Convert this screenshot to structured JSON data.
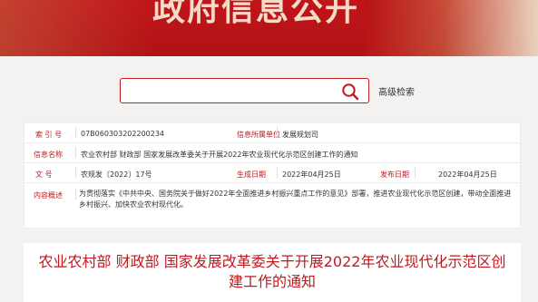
{
  "banner": {
    "title": "政府信息公开"
  },
  "search": {
    "placeholder": "",
    "advanced_label": "高级检索"
  },
  "info": {
    "index_no": {
      "label": "索 引 号",
      "value": "07B060303202200234"
    },
    "category": {
      "label": "信息所属单位",
      "value": "发展规划司"
    },
    "name": {
      "label": "信息名称",
      "value": "农业农村部 财政部 国家发展改革委关于开展2022年农业现代化示范区创建工作的通知"
    },
    "doc_no": {
      "label": "文 号",
      "value": "农规发〔2022〕17号"
    },
    "created": {
      "label": "生成日期",
      "value": "2022年04月25日"
    },
    "published": {
      "label": "发布日期",
      "value": "2022年04月25日"
    },
    "summary": {
      "label": "内容概述",
      "value": "为贯彻落实《中共中央、国务院关于做好2022年全面推进乡村振兴重点工作的意见》部署，推进农业现代化示范区创建，带动全面推进乡村振兴、加快农业农村现代化。"
    }
  },
  "article": {
    "title": "农业农村部 财政部 国家发展改革委关于开展2022年农业现代化示范区创建工作的通知"
  },
  "colors": {
    "accent": "#c0191e",
    "banner": "#c1151a",
    "background": "#f3f2f1"
  }
}
